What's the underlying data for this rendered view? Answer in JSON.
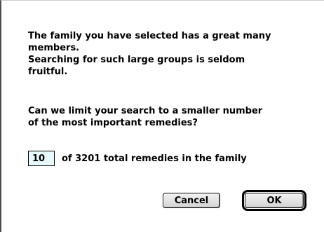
{
  "message": {
    "line1": "The family you have selected has a great many",
    "line2": "members.",
    "line3": "Searching for such large groups is seldom",
    "line4": "fruitful."
  },
  "question": {
    "line1": "Can we limit your search to a smaller number",
    "line2": "of the most important remedies?"
  },
  "limit": {
    "value": "10",
    "suffix": "of 3201 total remedies in the family"
  },
  "buttons": {
    "cancel_label": "Cancel",
    "ok_label": "OK"
  }
}
